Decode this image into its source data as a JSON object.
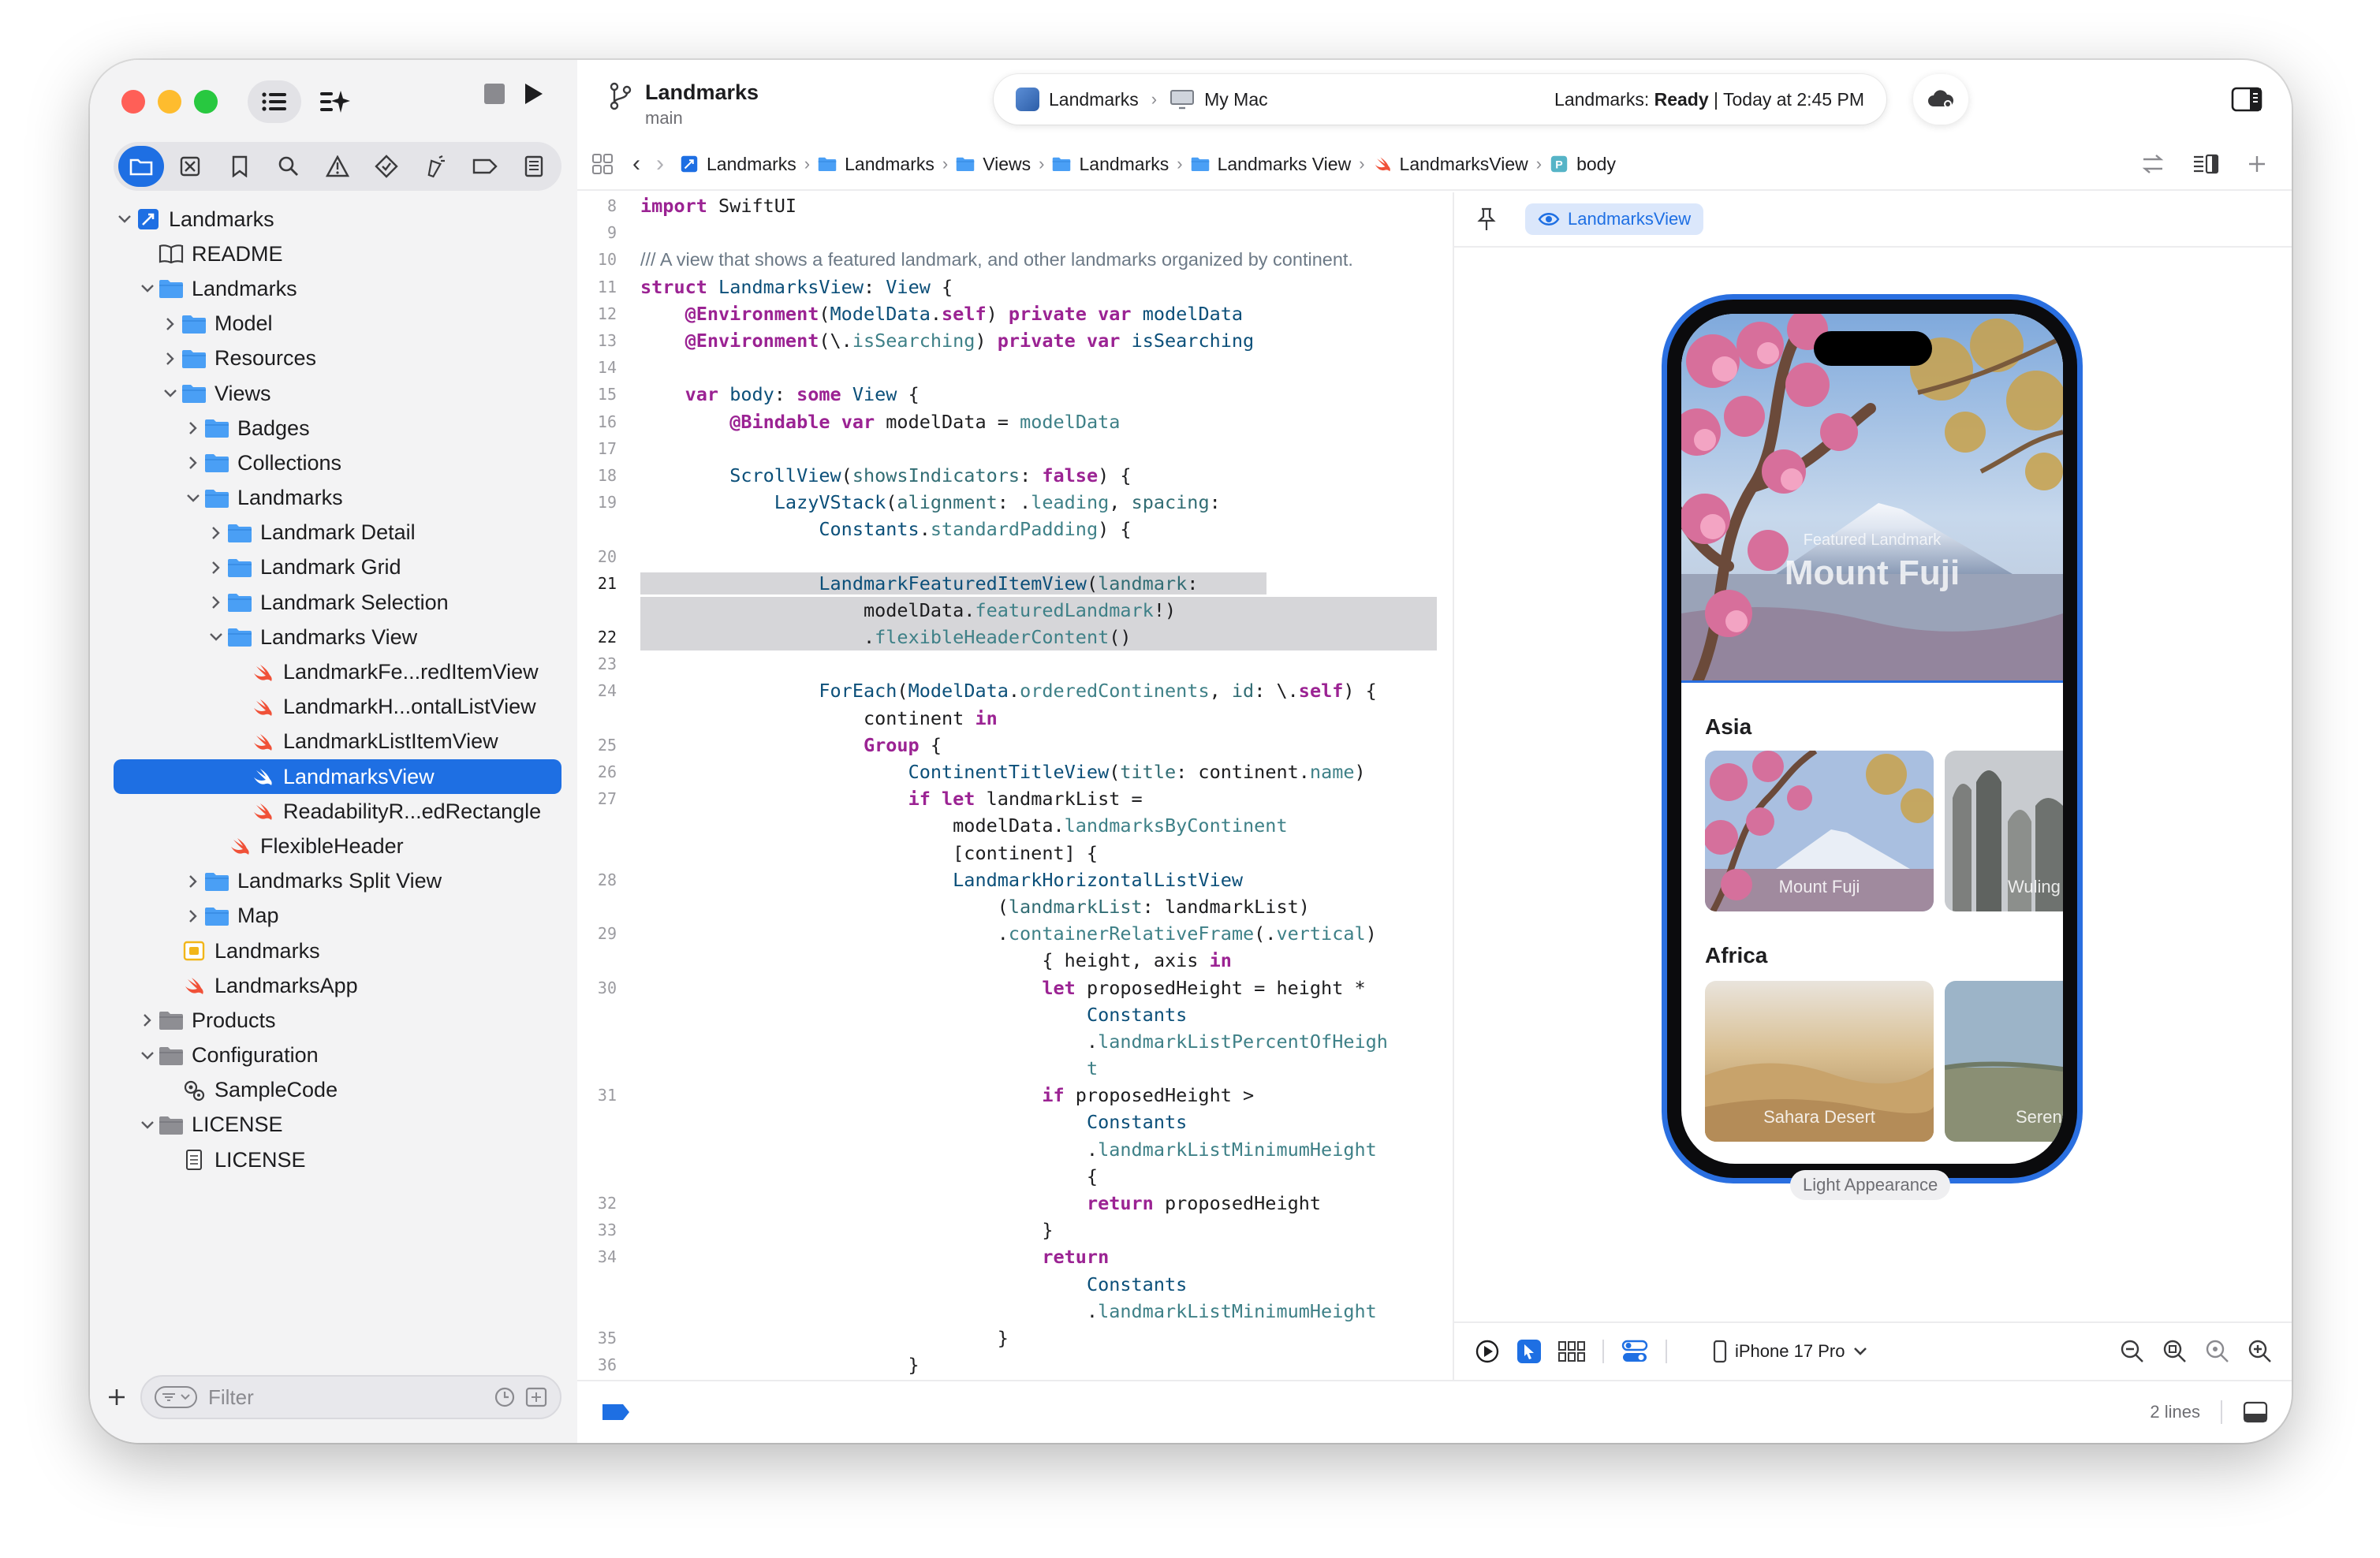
{
  "sidebar": {
    "filter_placeholder": "Filter",
    "tree": [
      {
        "label": "Landmarks",
        "level": 0,
        "icon": "project",
        "chev": "down"
      },
      {
        "label": "README",
        "level": 1,
        "icon": "book",
        "chev": ""
      },
      {
        "label": "Landmarks",
        "level": 1,
        "icon": "folder",
        "chev": "down"
      },
      {
        "label": "Model",
        "level": 2,
        "icon": "folder",
        "chev": "right"
      },
      {
        "label": "Resources",
        "level": 2,
        "icon": "folder",
        "chev": "right"
      },
      {
        "label": "Views",
        "level": 2,
        "icon": "folder",
        "chev": "down"
      },
      {
        "label": "Badges",
        "level": 3,
        "icon": "folder",
        "chev": "right"
      },
      {
        "label": "Collections",
        "level": 3,
        "icon": "folder",
        "chev": "right"
      },
      {
        "label": "Landmarks",
        "level": 3,
        "icon": "folder",
        "chev": "down"
      },
      {
        "label": "Landmark Detail",
        "level": 4,
        "icon": "folder",
        "chev": "right"
      },
      {
        "label": "Landmark Grid",
        "level": 4,
        "icon": "folder",
        "chev": "right"
      },
      {
        "label": "Landmark Selection",
        "level": 4,
        "icon": "folder",
        "chev": "right"
      },
      {
        "label": "Landmarks View",
        "level": 4,
        "icon": "folder",
        "chev": "down"
      },
      {
        "label": "LandmarkFe...redItemView",
        "level": 5,
        "icon": "swift",
        "chev": ""
      },
      {
        "label": "LandmarkH...ontalListView",
        "level": 5,
        "icon": "swift",
        "chev": ""
      },
      {
        "label": "LandmarkListItemView",
        "level": 5,
        "icon": "swift",
        "chev": ""
      },
      {
        "label": "LandmarksView",
        "level": 5,
        "icon": "swift",
        "chev": "",
        "selected": true
      },
      {
        "label": "ReadabilityR...edRectangle",
        "level": 5,
        "icon": "swift",
        "chev": ""
      },
      {
        "label": "FlexibleHeader",
        "level": 4,
        "icon": "swift",
        "chev": ""
      },
      {
        "label": "Landmarks Split View",
        "level": 3,
        "icon": "folder",
        "chev": "right"
      },
      {
        "label": "Map",
        "level": 3,
        "icon": "folder",
        "chev": "right"
      },
      {
        "label": "Landmarks",
        "level": 2,
        "icon": "entitlements",
        "chev": ""
      },
      {
        "label": "LandmarksApp",
        "level": 2,
        "icon": "swift",
        "chev": ""
      },
      {
        "label": "Products",
        "level": 1,
        "icon": "folder-gray",
        "chev": "right"
      },
      {
        "label": "Configuration",
        "level": 1,
        "icon": "folder-gray",
        "chev": "down"
      },
      {
        "label": "SampleCode",
        "level": 2,
        "icon": "config",
        "chev": ""
      },
      {
        "label": "LICENSE",
        "level": 1,
        "icon": "folder-gray",
        "chev": "down"
      },
      {
        "label": "LICENSE",
        "level": 2,
        "icon": "doc",
        "chev": ""
      }
    ]
  },
  "toolbar": {
    "project_title": "Landmarks",
    "branch": "main",
    "scheme": "Landmarks",
    "destination": "My Mac",
    "status_prefix": "Landmarks: ",
    "status_state": "Ready",
    "status_time": " | Today at 2:45 PM"
  },
  "jumpbar": {
    "crumbs": [
      {
        "label": "Landmarks",
        "icon": "project"
      },
      {
        "label": "Landmarks",
        "icon": "folder"
      },
      {
        "label": "Views",
        "icon": "folder"
      },
      {
        "label": "Landmarks",
        "icon": "folder"
      },
      {
        "label": "Landmarks View",
        "icon": "folder"
      },
      {
        "label": "LandmarksView",
        "icon": "swift"
      },
      {
        "label": "body",
        "icon": "property"
      }
    ]
  },
  "editor": {
    "lines": [
      {
        "n": "8",
        "html": "<span class='kw'>import</span> SwiftUI"
      },
      {
        "n": "9",
        "html": ""
      },
      {
        "n": "10",
        "html": "<span class='cm'>/// A view that shows a featured landmark, and other landmarks organized by continent.</span>"
      },
      {
        "n": "11",
        "html": "<span class='kw'>struct</span> <span class='ty'>LandmarksView</span>: <span class='ty'>View</span> {"
      },
      {
        "n": "12",
        "html": "    <span class='kw'>@Environment</span>(<span class='ty'>ModelData</span>.<span class='kw'>self</span>) <span class='kw'>private var</span> <span class='ty'>modelData</span>"
      },
      {
        "n": "13",
        "html": "    <span class='kw'>@Environment</span>(\\.<span class='mb'>isSearching</span>) <span class='kw'>private var</span> <span class='ty'>isSearching</span>"
      },
      {
        "n": "14",
        "html": ""
      },
      {
        "n": "15",
        "html": "    <span class='kw'>var</span> <span class='ty'>body</span>: <span class='kw'>some</span> <span class='ty'>View</span> {"
      },
      {
        "n": "16",
        "html": "        <span class='kw'>@Bindable</span> <span class='kw'>var</span> modelData = <span class='mb'>modelData</span>"
      },
      {
        "n": "17",
        "html": ""
      },
      {
        "n": "18",
        "html": "        <span class='ty'>ScrollView</span>(<span class='fn'>showsIndicators</span>: <span class='kw'>false</span>) {"
      },
      {
        "n": "19",
        "html": "            <span class='ty'>LazyVStack</span>(<span class='fn'>alignment</span>: .<span class='mb'>leading</span>, <span class='fn'>spacing</span>:"
      },
      {
        "n": "",
        "html": "                <span class='ty'>Constants</span>.<span class='mb'>standardPadding</span>) {"
      },
      {
        "n": "20",
        "html": ""
      },
      {
        "n": "21",
        "html": "<span class='hl'>                <span class='ty'>LandmarkFeaturedItemView</span>(<span class='fn'>landmark</span>:</span>",
        "cur": true,
        "hlfrom": 16
      },
      {
        "n": "",
        "html": "<span class='hl'>                    modelData.<span class='mb'>featuredLandmark</span>!)</span>",
        "full": true
      },
      {
        "n": "22",
        "html": "<span class='hl'>                    .<span class='mb'>flexibleHeaderContent</span>()</span>",
        "cur": true,
        "full": true
      },
      {
        "n": "23",
        "html": ""
      },
      {
        "n": "24",
        "html": "                <span class='ty'>ForEach</span>(<span class='ty'>ModelData</span>.<span class='mb'>orderedContinents</span>, <span class='fn'>id</span>: \\.<span class='kw'>self</span>) {"
      },
      {
        "n": "",
        "html": "                    continent <span class='kw'>in</span>"
      },
      {
        "n": "25",
        "html": "                    <span class='kw'>Group</span> {"
      },
      {
        "n": "26",
        "html": "                        <span class='ty'>ContinentTitleView</span>(<span class='fn'>title</span>: continent.<span class='mb'>name</span>)"
      },
      {
        "n": "27",
        "html": "                        <span class='kw'>if let</span> landmarkList ="
      },
      {
        "n": "",
        "html": "                            modelData.<span class='mb'>landmarksByContinent</span>"
      },
      {
        "n": "",
        "html": "                            [continent] {"
      },
      {
        "n": "28",
        "html": "                            <span class='ty'>LandmarkHorizontalListView</span>"
      },
      {
        "n": "",
        "html": "                                (<span class='fn'>landmarkList</span>: landmarkList)"
      },
      {
        "n": "29",
        "html": "                                .<span class='mb'>containerRelativeFrame</span>(.<span class='mb'>vertical</span>)"
      },
      {
        "n": "",
        "html": "                                    { height, axis <span class='kw'>in</span>"
      },
      {
        "n": "30",
        "html": "                                    <span class='kw'>let</span> proposedHeight = height *"
      },
      {
        "n": "",
        "html": "                                        <span class='ty'>Constants</span>"
      },
      {
        "n": "",
        "html": "                                        .<span class='mb'>landmarkListPercentOfHeigh</span>"
      },
      {
        "n": "",
        "html": "                                        <span class='mb'>t</span>"
      },
      {
        "n": "31",
        "html": "                                    <span class='kw'>if</span> proposedHeight >"
      },
      {
        "n": "",
        "html": "                                        <span class='ty'>Constants</span>"
      },
      {
        "n": "",
        "html": "                                        .<span class='mb'>landmarkListMinimumHeight</span>"
      },
      {
        "n": "",
        "html": "                                        {"
      },
      {
        "n": "32",
        "html": "                                        <span class='kw'>return</span> proposedHeight"
      },
      {
        "n": "33",
        "html": "                                    }"
      },
      {
        "n": "34",
        "html": "                                    <span class='kw'>return</span>"
      },
      {
        "n": "",
        "html": "                                        <span class='ty'>Constants</span>"
      },
      {
        "n": "",
        "html": "                                        .<span class='mb'>landmarkListMinimumHeight</span>"
      },
      {
        "n": "35",
        "html": "                                }"
      },
      {
        "n": "36",
        "html": "                        }"
      }
    ]
  },
  "canvas": {
    "view_chip": "LandmarksView",
    "hero_label": "Featured Landmark",
    "hero_title": "Mount Fuji",
    "section_asia": "Asia",
    "section_africa": "Africa",
    "card_fuji": "Mount Fuji",
    "card_wuling": "Wuling",
    "card_sahara": "Sahara Desert",
    "card_serengeti": "Seren",
    "appearance": "Light Appearance",
    "device": "iPhone 17 Pro"
  },
  "debug": {
    "lines": "2 lines"
  },
  "colors": {
    "accent": "#1e6fe3",
    "folder": "#4a9ff5",
    "swift": "#f05138"
  }
}
